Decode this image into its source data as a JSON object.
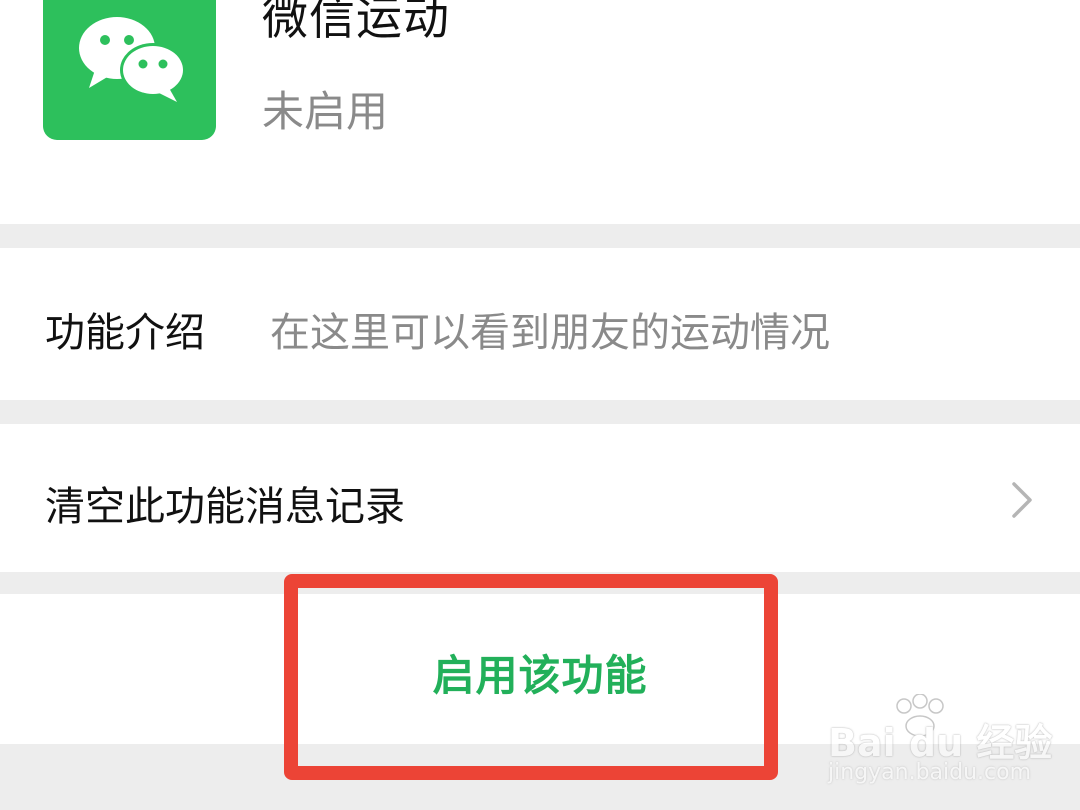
{
  "app": {
    "title": "微信运动",
    "status": "未启用",
    "icon": "wechat-logo-icon",
    "accent_color": "#2dc05c"
  },
  "rows": {
    "intro": {
      "label": "功能介绍",
      "description": "在这里可以看到朋友的运动情况"
    },
    "clear": {
      "label": "清空此功能消息记录",
      "icon": "chevron-right-icon"
    },
    "enable": {
      "label": "启用该功能",
      "color": "#22b05a"
    }
  },
  "highlight": {
    "color": "#ec4436"
  },
  "watermark": {
    "logo": "Bai du 经验",
    "url": "jingyan.baidu.com"
  }
}
